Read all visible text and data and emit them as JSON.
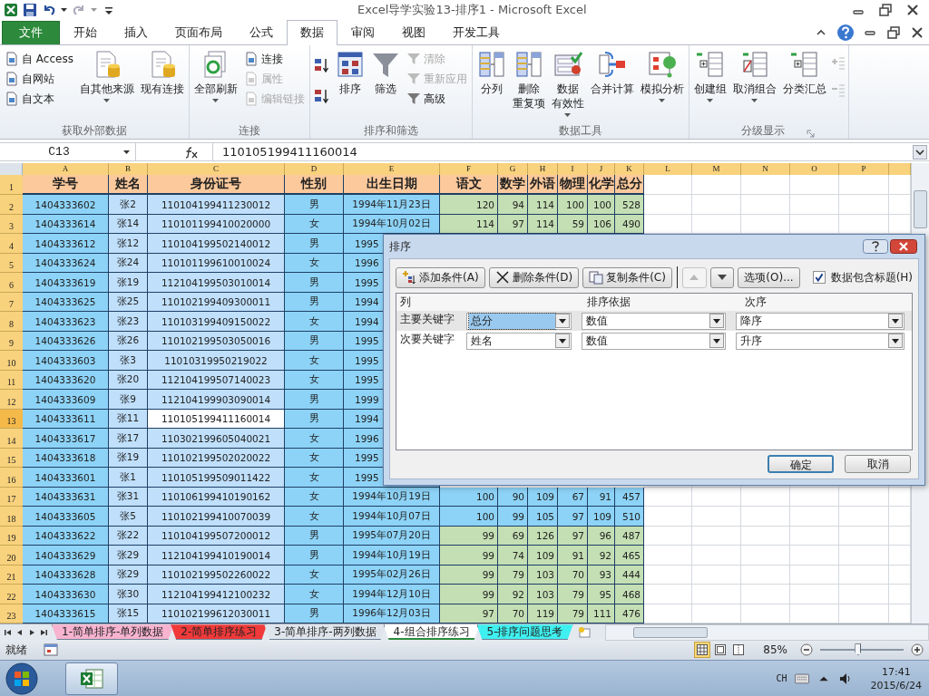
{
  "title_bar": {
    "title": "Excel导学实验13-排序1  -  Microsoft Excel"
  },
  "ribbon_tabs": [
    {
      "label": "文件",
      "kind": "file",
      "selected": false
    },
    {
      "label": "开始",
      "kind": "tab",
      "selected": false
    },
    {
      "label": "插入",
      "kind": "tab",
      "selected": false
    },
    {
      "label": "页面布局",
      "kind": "tab",
      "selected": false
    },
    {
      "label": "公式",
      "kind": "tab",
      "selected": false
    },
    {
      "label": "数据",
      "kind": "tab",
      "selected": true
    },
    {
      "label": "审阅",
      "kind": "tab",
      "selected": false
    },
    {
      "label": "视图",
      "kind": "tab",
      "selected": false
    },
    {
      "label": "开发工具",
      "kind": "tab",
      "selected": false
    }
  ],
  "ribbon_groups": [
    {
      "label": "获取外部数据",
      "launcher": false,
      "columns": [
        {
          "kind": "stack",
          "buttons": [
            {
              "label": "自 Access",
              "disabled": false
            },
            {
              "label": "自网站",
              "disabled": false
            },
            {
              "label": "自文本",
              "disabled": false
            }
          ]
        },
        {
          "kind": "large",
          "label": "自其他来源",
          "dropdown": true
        },
        {
          "kind": "large",
          "label": "现有连接",
          "dropdown": false
        }
      ]
    },
    {
      "label": "连接",
      "launcher": false,
      "columns": [
        {
          "kind": "large",
          "label": "全部刷新",
          "dropdown": true
        },
        {
          "kind": "stack",
          "buttons": [
            {
              "label": "连接",
              "disabled": false
            },
            {
              "label": "属性",
              "disabled": true
            },
            {
              "label": "编辑链接",
              "disabled": true
            }
          ]
        }
      ]
    },
    {
      "label": "排序和筛选",
      "launcher": false,
      "columns": [
        {
          "kind": "sort-pair"
        },
        {
          "kind": "large",
          "label": "排序",
          "dropdown": false
        },
        {
          "kind": "large",
          "label": "筛选",
          "dropdown": false
        },
        {
          "kind": "stack",
          "buttons": [
            {
              "label": "清除",
              "disabled": true
            },
            {
              "label": "重新应用",
              "disabled": true
            },
            {
              "label": "高级",
              "disabled": false
            }
          ]
        }
      ]
    },
    {
      "label": "数据工具",
      "launcher": false,
      "columns": [
        {
          "kind": "large",
          "label": "分列",
          "dropdown": false
        },
        {
          "kind": "large",
          "lines": [
            "删除",
            "重复项"
          ],
          "dropdown": false
        },
        {
          "kind": "large",
          "lines": [
            "数据",
            "有效性"
          ],
          "dropdown": true
        },
        {
          "kind": "large",
          "label": "合并计算",
          "dropdown": false
        },
        {
          "kind": "large",
          "label": "模拟分析",
          "dropdown": true
        }
      ]
    },
    {
      "label": "分级显示",
      "launcher": true,
      "columns": [
        {
          "kind": "large",
          "label": "创建组",
          "dropdown": true
        },
        {
          "kind": "large",
          "label": "取消组合",
          "dropdown": true
        },
        {
          "kind": "large",
          "label": "分类汇总",
          "dropdown": false
        },
        {
          "kind": "detail-pair"
        }
      ]
    }
  ],
  "formula_bar": {
    "name_box": "C13",
    "formula": "110105199411160014"
  },
  "sheet": {
    "columns": [
      "A",
      "B",
      "C",
      "D",
      "E",
      "F",
      "G",
      "H",
      "I",
      "J",
      "K",
      "L",
      "M",
      "N",
      "O",
      "P"
    ],
    "header_row": {
      "num": "1",
      "cells": [
        "学号",
        "姓名",
        "身份证号",
        "性别",
        "出生日期",
        "语文",
        "数学",
        "外语",
        "物理",
        "化学",
        "总分"
      ]
    },
    "rows": [
      {
        "num": "2",
        "selected": false,
        "color": "#c4dfb4",
        "cells": [
          "1404333602",
          "张2",
          "110104199411230012",
          "男",
          "1994年11月23日",
          "120",
          "94",
          "114",
          "100",
          "100",
          "528"
        ]
      },
      {
        "num": "3",
        "selected": false,
        "color": "#c4dfb4",
        "cells": [
          "1404333614",
          "张14",
          "110101199410020000",
          "女",
          "1994年10月02日",
          "114",
          "97",
          "114",
          "59",
          "106",
          "490"
        ]
      },
      {
        "num": "4",
        "selected": false,
        "cells": [
          "1404333612",
          "张12",
          "110104199502140012",
          "男",
          "1995"
        ]
      },
      {
        "num": "5",
        "selected": false,
        "cells": [
          "1404333624",
          "张24",
          "110101199610010024",
          "女",
          "1996"
        ]
      },
      {
        "num": "6",
        "selected": false,
        "cells": [
          "1404333619",
          "张19",
          "112104199503010014",
          "男",
          "1995"
        ]
      },
      {
        "num": "7",
        "selected": false,
        "cells": [
          "1404333625",
          "张25",
          "110102199409300011",
          "男",
          "1994"
        ]
      },
      {
        "num": "8",
        "selected": false,
        "cells": [
          "1404333623",
          "张23",
          "110103199409150022",
          "女",
          "1994"
        ]
      },
      {
        "num": "9",
        "selected": false,
        "cells": [
          "1404333626",
          "张26",
          "110102199503050016",
          "男",
          "1995"
        ]
      },
      {
        "num": "10",
        "selected": false,
        "cells": [
          "1404333603",
          "张3",
          "11010319950219022",
          "女",
          "1995"
        ]
      },
      {
        "num": "11",
        "selected": false,
        "cells": [
          "1404333620",
          "张20",
          "112104199507140023",
          "女",
          "1995"
        ]
      },
      {
        "num": "12",
        "selected": false,
        "cells": [
          "1404333609",
          "张9",
          "112104199903090014",
          "男",
          "1999"
        ]
      },
      {
        "num": "13",
        "selected": true,
        "cells": [
          "1404333611",
          "张11",
          "110105199411160014",
          "男",
          "1994"
        ]
      },
      {
        "num": "14",
        "selected": false,
        "cells": [
          "1404333617",
          "张17",
          "110302199605040021",
          "女",
          "1996"
        ]
      },
      {
        "num": "15",
        "selected": false,
        "cells": [
          "1404333618",
          "张19",
          "110102199502020022",
          "女",
          "1995"
        ]
      },
      {
        "num": "16",
        "selected": false,
        "cells": [
          "1404333601",
          "张1",
          "110105199509011422",
          "女",
          "1995"
        ]
      },
      {
        "num": "17",
        "selected": false,
        "color": "#8dd3f7",
        "cells": [
          "1404333631",
          "张31",
          "110106199410190162",
          "女",
          "1994年10月19日",
          "100",
          "90",
          "109",
          "67",
          "91",
          "457"
        ]
      },
      {
        "num": "18",
        "selected": false,
        "color": "#8dd3f7",
        "cells": [
          "1404333605",
          "张5",
          "110102199410070039",
          "女",
          "1994年10月07日",
          "100",
          "99",
          "105",
          "97",
          "109",
          "510"
        ]
      },
      {
        "num": "19",
        "selected": false,
        "color": "#c4dfb4",
        "cells": [
          "1404333622",
          "张22",
          "110104199507200012",
          "男",
          "1995年07月20日",
          "99",
          "69",
          "126",
          "97",
          "96",
          "487"
        ]
      },
      {
        "num": "20",
        "selected": false,
        "color": "#c4dfb4",
        "cells": [
          "1404333629",
          "张29",
          "112104199410190014",
          "男",
          "1994年10月19日",
          "99",
          "74",
          "109",
          "91",
          "92",
          "465"
        ]
      },
      {
        "num": "21",
        "selected": false,
        "color": "#c4dfb4",
        "cells": [
          "1404333628",
          "张29",
          "110102199502260022",
          "女",
          "1995年02月26日",
          "99",
          "79",
          "103",
          "70",
          "93",
          "444"
        ]
      },
      {
        "num": "22",
        "selected": false,
        "color": "#c4dfb4",
        "cells": [
          "1404333630",
          "张30",
          "112104199412100232",
          "女",
          "1994年12月10日",
          "99",
          "92",
          "103",
          "79",
          "95",
          "468"
        ]
      },
      {
        "num": "23",
        "selected": false,
        "color": "#c4dfb4",
        "cells": [
          "1404333615",
          "张15",
          "110102199612030011",
          "男",
          "1996年12月03日",
          "97",
          "70",
          "119",
          "79",
          "111",
          "476"
        ]
      }
    ]
  },
  "dialog": {
    "title": "排序",
    "toolbar": [
      {
        "kind": "add",
        "label": "添加条件(A)",
        "disabled": false
      },
      {
        "kind": "delete",
        "label": "删除条件(D)",
        "disabled": false
      },
      {
        "kind": "copy",
        "label": "复制条件(C)",
        "disabled": false
      },
      {
        "kind": "up",
        "disabled": true
      },
      {
        "kind": "down",
        "disabled": false
      },
      {
        "kind": "options",
        "label": "选项(O)...",
        "disabled": false
      }
    ],
    "has_headers": {
      "label": "数据包含标题(H)",
      "checked": true
    },
    "headers": [
      "列",
      "排序依据",
      "次序"
    ],
    "levels": [
      {
        "label": "主要关键字",
        "column": "总分",
        "basis": "数值",
        "order": "降序",
        "selected": true
      },
      {
        "label": "次要关键字",
        "column": "姓名",
        "basis": "数值",
        "order": "升序",
        "selected": false
      }
    ],
    "buttons": [
      {
        "label": "确定",
        "default": true
      },
      {
        "label": "取消",
        "default": false
      }
    ]
  },
  "sheet_tabs": [
    {
      "label": "1-简单排序-单列数据",
      "color": "#f7b3cf",
      "selected": false
    },
    {
      "label": "2-简单排序练习",
      "color": "#f03a3a",
      "selected": false
    },
    {
      "label": "3-简单排序-两列数据",
      "selected": false
    },
    {
      "label": "4-组合排序练习",
      "selected": true
    },
    {
      "label": "5-排序问题思考",
      "color": "#3ff0f0",
      "selected": false
    }
  ],
  "status_bar": {
    "status": "就绪",
    "views": [
      {
        "kind": "normal",
        "selected": true
      },
      {
        "kind": "page-layout",
        "selected": false
      },
      {
        "kind": "page-break",
        "selected": false
      }
    ],
    "zoom": "85%",
    "zoom_slider": {
      "level": 0.45
    }
  },
  "taskbar": {
    "language": "CH",
    "time": "17:41",
    "date": "2015/6/24"
  }
}
